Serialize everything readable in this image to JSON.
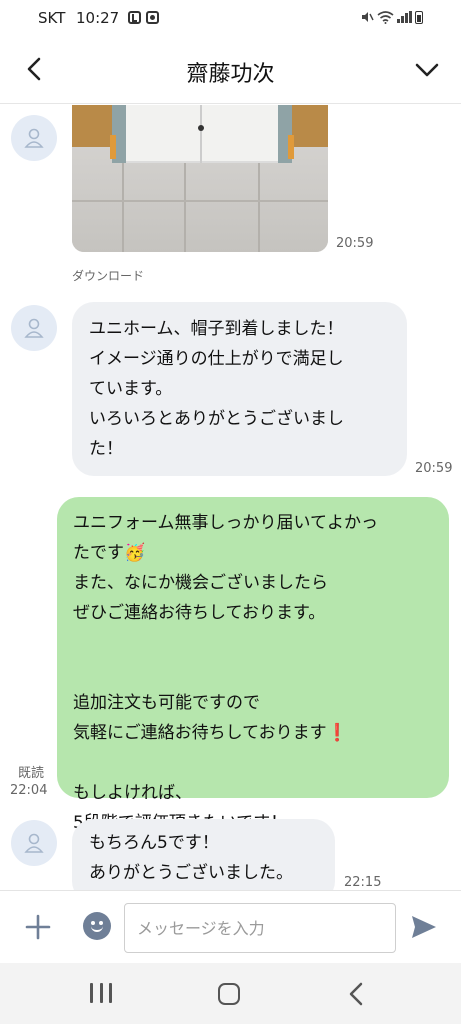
{
  "status_bar": {
    "carrier": "SKT",
    "time": "10:27"
  },
  "header": {
    "title": "齋藤功次"
  },
  "messages": {
    "photo_time": "20:59",
    "download_label": "ダウンロード",
    "msg1_text": "ユニホーム、帽子到着しました！\nイメージ通りの仕上がりで満足し\nています。\nいろいろとありがとうございまし\nた！",
    "msg1_time": "20:59",
    "msg2_text": "ユニフォーム無事しっかり届いてよかっ\nたです🥳\nまた、なにか機会ございましたら\nぜひご連絡お待ちしております。\n\n\n追加注文も可能ですので\n気軽にご連絡お待ちしております❗️\n\nもしよければ、\n5段階で評価頂きたいです！",
    "msg2_read": "既読",
    "msg2_time": "22:04",
    "msg3_text": "もちろん5です！\nありがとうございました。",
    "msg3_time": "22:15"
  },
  "composer": {
    "placeholder": "メッセージを入力"
  },
  "colors": {
    "sent_bubble": "#b6e6ad",
    "received_bubble": "#eef0f3",
    "avatar_bg": "#e4ebf5",
    "icon_accent": "#6f7f97"
  }
}
